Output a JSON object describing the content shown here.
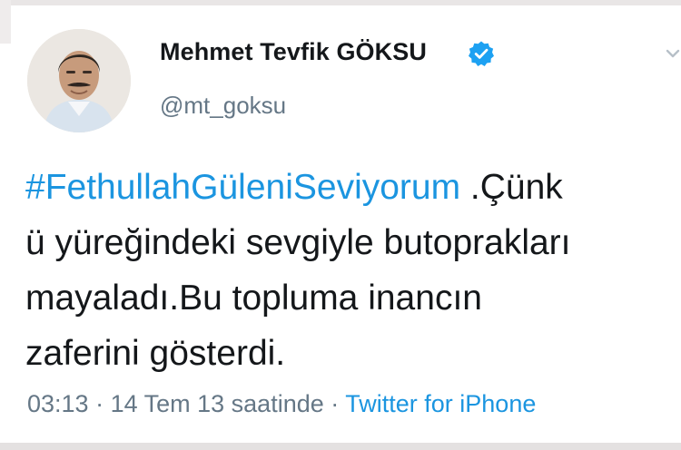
{
  "tweet": {
    "author": {
      "display_name": "Mehmet Tevfik GÖKSU",
      "handle": "@mt_goksu",
      "verified": true
    },
    "body": {
      "hashtag": "#FethullahGüleniSeviyorum",
      "line1_rest": " .Çünk",
      "line2": "ü yüreğindeki sevgiyle butoprakları",
      "line3": "mayaladı.Bu topluma inancın",
      "line4": "zaferini gösterdi."
    },
    "meta": {
      "time": "03:13",
      "separator1": " · ",
      "date": "14 Tem 13 saatinde",
      "separator2": " · ",
      "source": "Twitter for iPhone"
    }
  },
  "colors": {
    "text": "#14171a",
    "secondary_text": "#657786",
    "link": "#1b95e0",
    "verified_badge": "#1da1f2"
  },
  "icons": {
    "avatar": "profile-photo",
    "verified": "verified-badge-icon",
    "menu": "chevron-down-icon"
  }
}
